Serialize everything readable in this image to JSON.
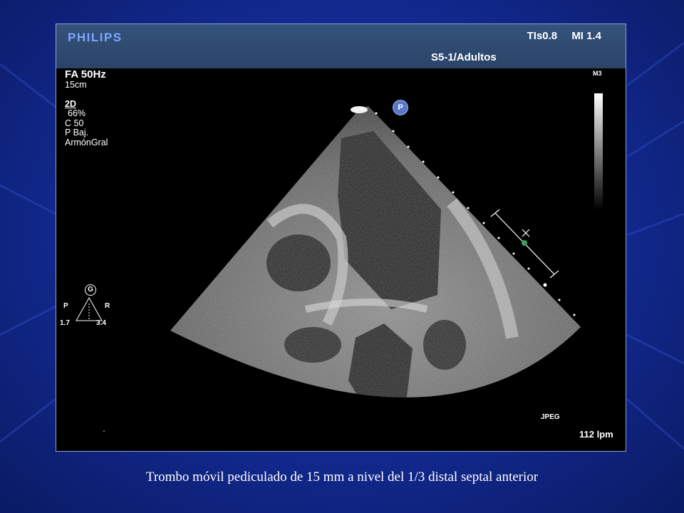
{
  "header": {
    "brand": "PHILIPS",
    "tis": "TIs0.8",
    "mi": "MI 1.4",
    "probe": "S5-1/Adultos"
  },
  "params": {
    "frame_rate": "FA 50Hz",
    "depth": "15cm",
    "mode": "2D",
    "gain": "66%",
    "compression": "C 50",
    "power": "P Baj.",
    "harmonics": "ArmónGral"
  },
  "map": "M3",
  "orientation": {
    "badge": "G",
    "left_label": "P",
    "right_label": "R",
    "left_value": "1.7",
    "right_value": "3.4"
  },
  "marker_p": "P",
  "jpeg_label": "JPEG",
  "heart_rate": "112 lpm",
  "caption": "Trombo móvil pediculado de 15 mm a nivel del 1/3 distal septal anterior",
  "colors": {
    "background": "#12298f",
    "header_band": "#2f4a72",
    "brand": "#7fa6ff",
    "caliper_marker": "#3aa05a"
  }
}
